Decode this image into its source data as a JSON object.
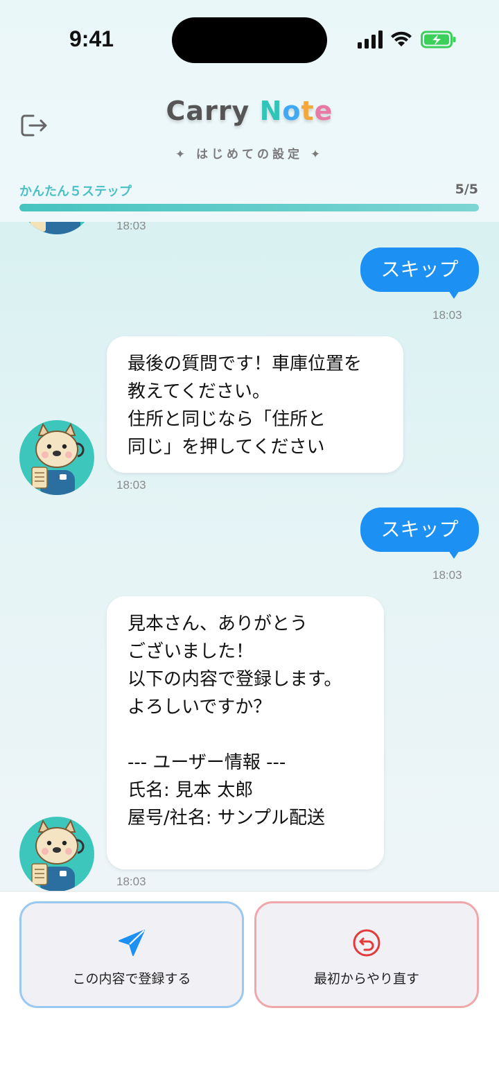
{
  "status_bar": {
    "time": "9:41"
  },
  "header": {
    "logo": {
      "part1": "Carry ",
      "n": "N",
      "o": "o",
      "t": "t",
      "e": "e"
    },
    "subtitle": "✦ はじめての設定 ✦",
    "steps_label": "かんたん５ステップ",
    "steps_count": "5/5",
    "progress": 1.0
  },
  "chat": {
    "messages": [
      {
        "from": "bot",
        "time": "18:03"
      },
      {
        "from": "user",
        "text": "スキップ",
        "time": "18:03"
      },
      {
        "from": "bot",
        "text": "最後の質問です！車庫位置を\n教えてください。\n住所と同じなら「住所と\n同じ」を押してください",
        "time": "18:03"
      },
      {
        "from": "user",
        "text": "スキップ",
        "time": "18:03"
      },
      {
        "from": "bot",
        "text": "見本さん、ありがとう\nございました！\n以下の内容で登録します。\nよろしいですか？\n\n--- ユーザー情報 ---\n氏名: 見本 太郎\n屋号/社名: サンプル配送",
        "time": "18:03"
      }
    ]
  },
  "actions": {
    "register_label": "この内容で登録する",
    "reset_label": "最初からやり直す"
  },
  "colors": {
    "accent_teal": "#49c0c5",
    "user_bubble": "#1d90f3",
    "register_border": "#9ac8f1",
    "reset_border": "#f0a7aa"
  }
}
